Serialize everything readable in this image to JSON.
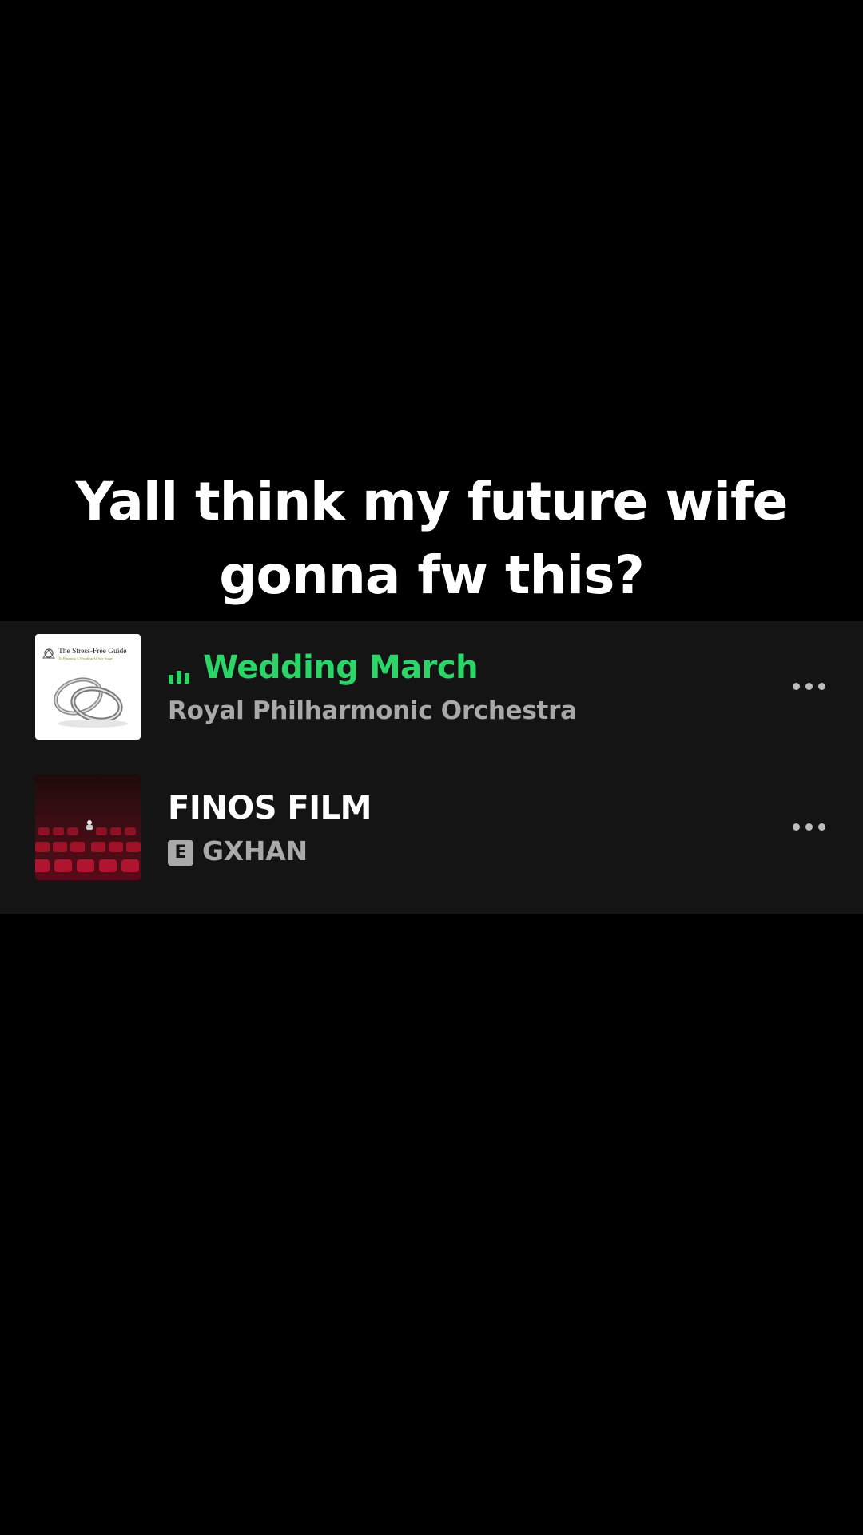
{
  "caption": {
    "line1": "Yall think my future wife",
    "line2": "gonna fw this?"
  },
  "tracks": [
    {
      "title": "Wedding March",
      "artist": "Royal Philharmonic Orchestra",
      "now_playing": true,
      "explicit": false,
      "artwork": {
        "header": "The Stress-Free Guide",
        "subheader": "To Planning A Wedding At Any Stage",
        "icon": "wedding-rings-icon"
      }
    },
    {
      "title": "FINOS FILM",
      "artist": "GXHAN",
      "now_playing": false,
      "explicit": true,
      "explicit_label": "E",
      "artwork": {
        "icon": "cinema-seats-icon"
      }
    }
  ],
  "colors": {
    "background": "#000000",
    "panel": "#141414",
    "accent_green": "#2bd568",
    "text_primary": "#ffffff",
    "text_secondary": "#a9a9a9"
  },
  "icons": {
    "now_playing": "equalizer-bars-icon",
    "more": "more-options-icon"
  }
}
